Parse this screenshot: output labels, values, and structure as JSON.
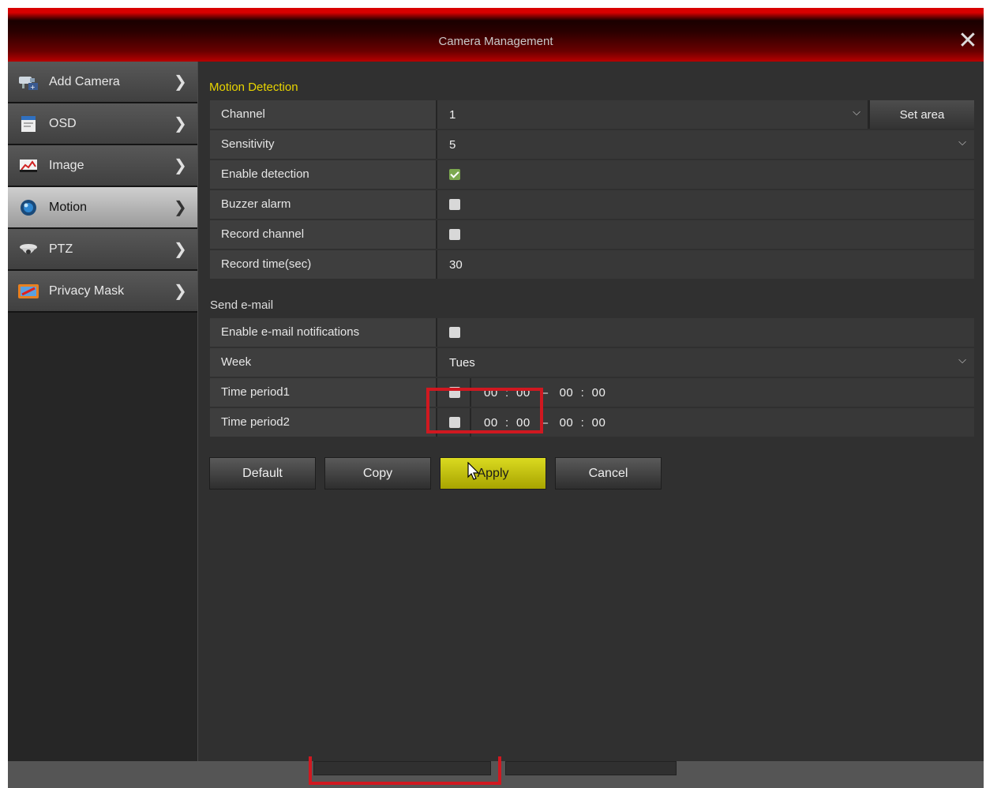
{
  "window": {
    "title": "Camera Management"
  },
  "sidebar": {
    "items": [
      {
        "label": "Add Camera",
        "icon": "camera-add-icon"
      },
      {
        "label": "OSD",
        "icon": "osd-icon"
      },
      {
        "label": "Image",
        "icon": "image-icon"
      },
      {
        "label": "Motion",
        "icon": "motion-icon",
        "active": true
      },
      {
        "label": "PTZ",
        "icon": "ptz-icon"
      },
      {
        "label": "Privacy Mask",
        "icon": "privacy-mask-icon"
      }
    ]
  },
  "motion": {
    "section_title": "Motion Detection",
    "channel": {
      "label": "Channel",
      "value": "1",
      "set_area": "Set area"
    },
    "sensitivity": {
      "label": "Sensitivity",
      "value": "5"
    },
    "enable_detection": {
      "label": "Enable detection",
      "checked": true
    },
    "buzzer_alarm": {
      "label": "Buzzer alarm",
      "checked": false
    },
    "record_channel": {
      "label": "Record channel",
      "checked": false
    },
    "record_time": {
      "label": "Record time(sec)",
      "value": "30"
    }
  },
  "email": {
    "section_title": "Send e-mail",
    "enable": {
      "label": "Enable e-mail notifications",
      "checked": false
    },
    "week": {
      "label": "Week",
      "value": "Tues"
    },
    "period1": {
      "label": "Time period1",
      "checked": false,
      "start_h": "00",
      "start_m": "00",
      "end_h": "00",
      "end_m": "00"
    },
    "period2": {
      "label": "Time period2",
      "checked": false,
      "start_h": "00",
      "start_m": "00",
      "end_h": "00",
      "end_m": "00"
    }
  },
  "buttons": {
    "default": "Default",
    "copy": "Copy",
    "apply": "Apply",
    "cancel": "Cancel"
  },
  "colors": {
    "accent_red": "#d01820",
    "apply_yellow": "#c8c400",
    "section_yellow": "#e8d400"
  }
}
